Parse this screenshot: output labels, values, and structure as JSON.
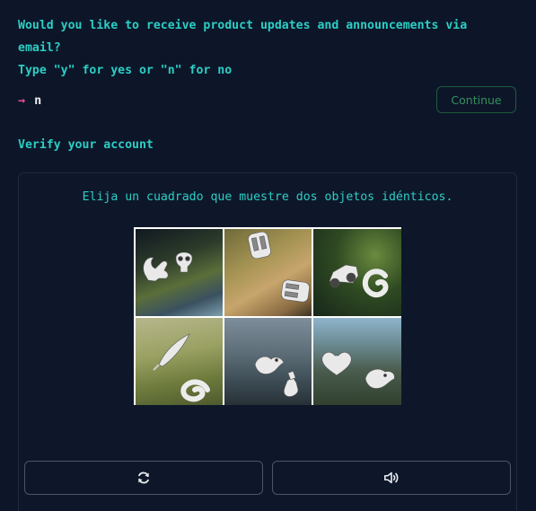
{
  "prompt": {
    "question_line1": "Would you like to receive product updates and announcements via",
    "question_line2": "email?",
    "question_line3": "Type \"y\" for yes or \"n\" for no",
    "arrow": "→",
    "answer": "n"
  },
  "continue_button": {
    "label": "Continue"
  },
  "verify": {
    "heading": "Verify your account"
  },
  "captcha": {
    "instruction": "Elija un cuadrado que muestre dos objetos idénticos.",
    "tiles": [
      {
        "icons": [
          "squirrel-icon",
          "skull-icon"
        ]
      },
      {
        "icons": [
          "astronaut-icon",
          "astronaut-icon"
        ]
      },
      {
        "icons": [
          "car-icon",
          "spiral-shell-icon"
        ]
      },
      {
        "icons": [
          "feather-icon",
          "spiral-shell-icon"
        ]
      },
      {
        "icons": [
          "bird-icon",
          "bottle-icon"
        ]
      },
      {
        "icons": [
          "heart-icon",
          "bird-icon"
        ]
      }
    ],
    "refresh_icon": "refresh-icon",
    "audio_icon": "speaker-icon"
  },
  "colors": {
    "background": "#0d1629",
    "accent": "#2ccec4",
    "arrow": "#e8508f",
    "continue": "#33905c"
  }
}
